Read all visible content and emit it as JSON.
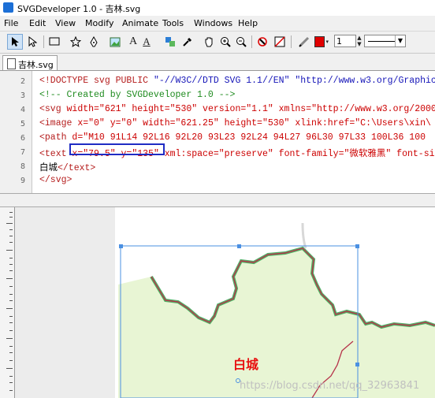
{
  "window": {
    "title": "SVGDeveloper 1.0 - 吉林.svg"
  },
  "menu": [
    "File",
    "Edit",
    "View",
    "Modify",
    "Animate",
    "Tools",
    "Windows",
    "Help"
  ],
  "toolbar": {
    "icons": [
      "select-arrow-icon",
      "direct-select-icon",
      "rectangle-icon",
      "star-icon",
      "pen-icon",
      "image-icon",
      "text-icon",
      "text-path-icon",
      "transform-icon",
      "eyedropper-icon",
      "hand-icon",
      "zoom-in-icon",
      "zoom-out-icon",
      "no-stroke-icon",
      "no-fill-icon",
      "pencil-icon",
      "stroke-color-icon"
    ],
    "stroke_width": "1",
    "stroke_color": "#e00000"
  },
  "tab": {
    "label": "吉林.svg"
  },
  "editor": {
    "line_numbers": [
      "2",
      "3",
      "4",
      "5",
      "6",
      "7",
      "8",
      "9"
    ],
    "lines": [
      {
        "tag": "<!DOCTYPE svg PUBLIC ",
        "rest": "\"-//W3C//DTD SVG 1.1//EN\" \"http://www.w3.org/Graphics/SVG/1.1/DTD/svg11.dtd\">"
      },
      {
        "comment": "<!-- Created by SVGDeveloper 1.0 -->"
      },
      {
        "tag": "<svg ",
        "rest": "width=\"621\" height=\"530\" version=\"1.1\" xmlns=\"http://www.w3.org/2000/svg\""
      },
      {
        "tag": "<image ",
        "rest": "x=\"0\" y=\"0\" width=\"621.25\" height=\"530\" xlink:href=\"C:\\Users\\xin\\"
      },
      {
        "tag": "<path ",
        "rest": "d=\"M10 91L14 92L16 92L20 93L23 92L24 94L27 96L30 97L33 100L36 100"
      },
      {
        "tag": "<text ",
        "highlight": "x=\"79.5\" y=\"135\"",
        "rest": " xml:space=\"preserve\" font-family=\"微软雅黑\" font-size"
      },
      {
        "text": "白城",
        "close": "</text>"
      },
      {
        "tag": "</svg>"
      }
    ]
  },
  "canvas": {
    "region_label": "白城",
    "watermark": "https://blog.csdn.net/qq_32963841",
    "colors": {
      "region_fill": "#e8f5d4",
      "border_green": "#34a24f",
      "border_red": "#b6334a",
      "label_red": "#e81010"
    }
  }
}
